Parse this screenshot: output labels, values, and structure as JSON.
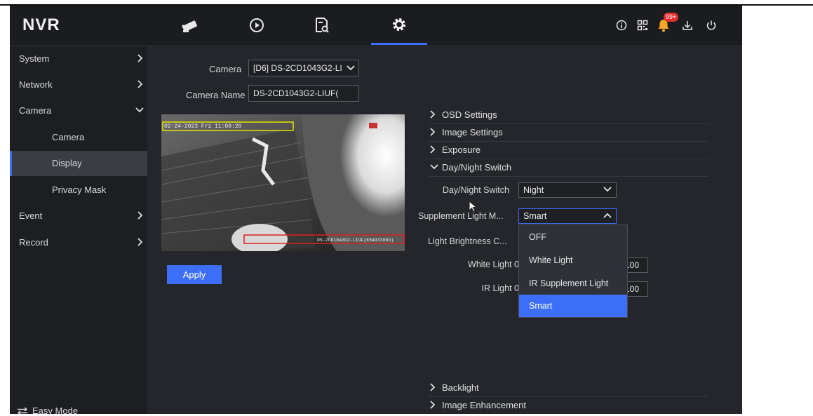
{
  "app": {
    "logo": "NVR"
  },
  "topnav": {
    "icons": [
      "camera-icon",
      "playback-icon",
      "search-file-icon",
      "settings-icon"
    ],
    "active_index": 3,
    "right_icons": [
      "info-icon",
      "qr-code-icon",
      "alarm-bell-icon",
      "download-icon",
      "power-icon"
    ],
    "alarm_badge": "99+"
  },
  "sidebar": {
    "items": [
      {
        "label": "System",
        "chevron": "right"
      },
      {
        "label": "Network",
        "chevron": "right"
      },
      {
        "label": "Camera",
        "chevron": "down"
      },
      {
        "label": "Camera",
        "sub": true
      },
      {
        "label": "Display",
        "sub": true,
        "active": true
      },
      {
        "label": "Privacy Mask",
        "sub": true
      },
      {
        "label": "Event",
        "chevron": "right"
      },
      {
        "label": "Record",
        "chevron": "right"
      }
    ],
    "easy_mode": "Easy Mode"
  },
  "form": {
    "camera_label": "Camera",
    "camera_value": "[D6] DS-2CD1043G2-LI",
    "camera_name_label": "Camera Name",
    "camera_name_value": "DS-2CD1043G2-LIUF(",
    "apply_label": "Apply"
  },
  "preview": {
    "osd_date": "02-24-2023 Fri 11:08:20",
    "osd_name": "DS-2CD1043G2-LIUF(K54933003)"
  },
  "sections": {
    "osd": "OSD Settings",
    "image": "Image Settings",
    "exposure": "Exposure",
    "daynight": "Day/Night Switch",
    "backlight": "Backlight",
    "enhancement": "Image Enhancement"
  },
  "daynight": {
    "switch_label": "Day/Night Switch",
    "switch_value": "Night",
    "supplement_label": "Supplement Light M...",
    "supplement_value": "Smart",
    "brightness_label": "Light Brightness C...",
    "white_label": "White Light",
    "white_min": "0",
    "white_value": "100",
    "ir_label": "IR Light",
    "ir_min": "0",
    "ir_value": "100"
  },
  "dropdown": {
    "options": [
      "OFF",
      "White Light",
      "IR Supplement Light",
      "Smart"
    ],
    "selected_index": 3
  },
  "colors": {
    "accent": "#3d6ef8",
    "background": "#24262b",
    "topbar": "#1a1c20"
  }
}
